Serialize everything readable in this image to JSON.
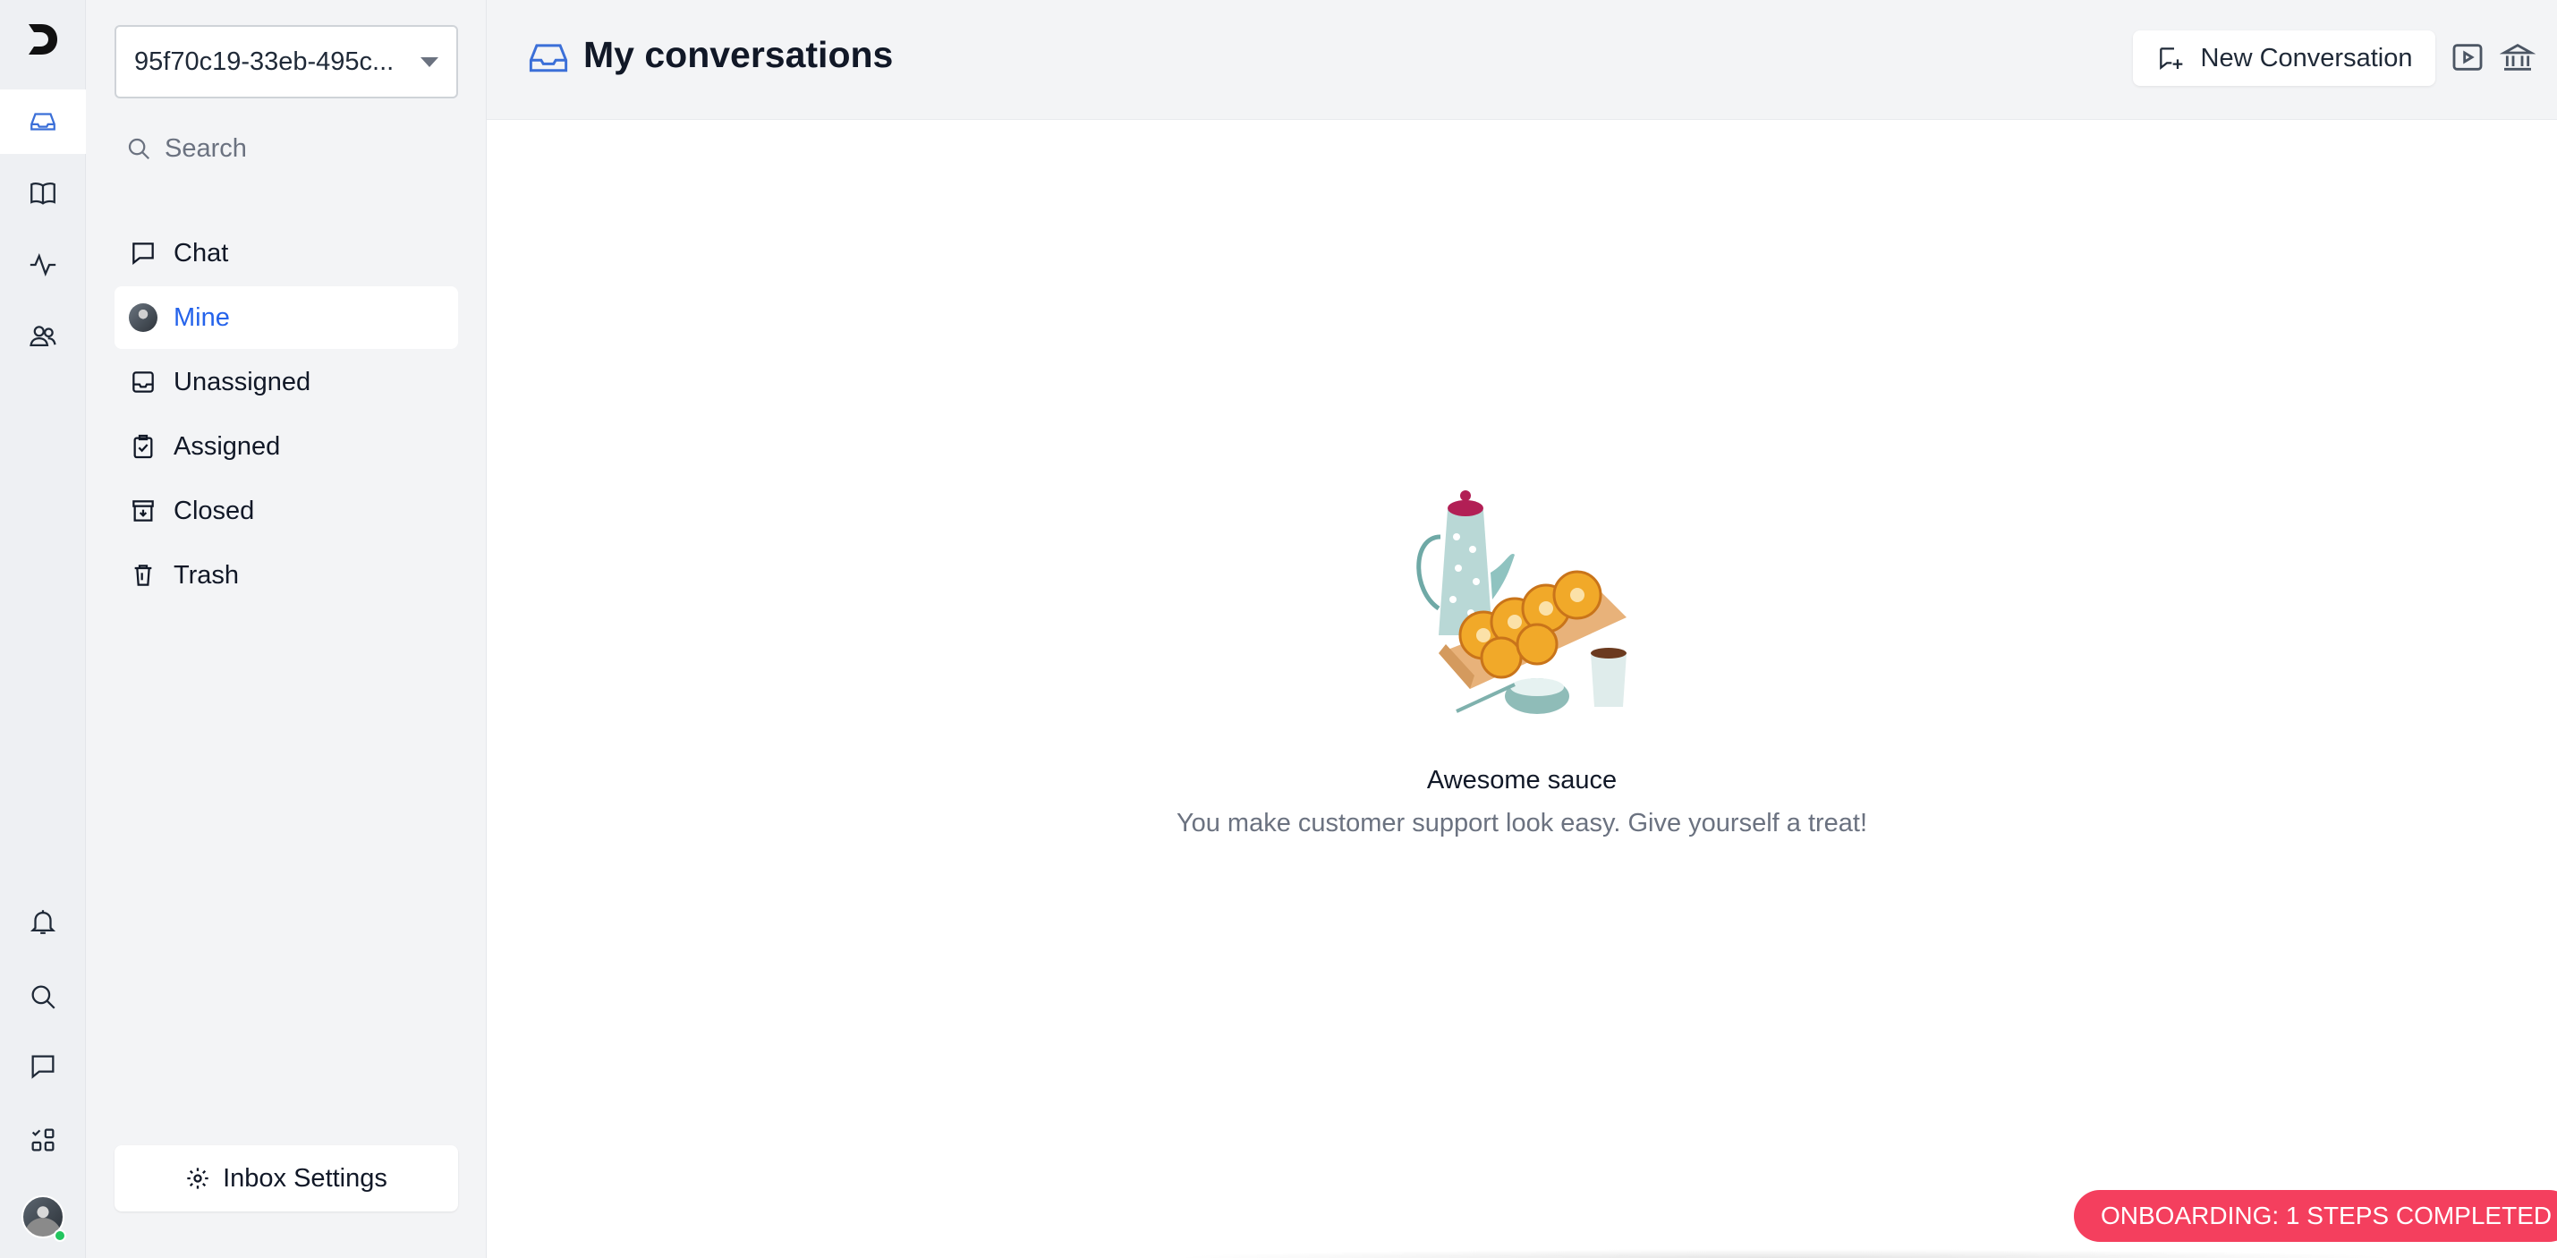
{
  "rail": {
    "logo": "D-logo-icon",
    "top_icons": [
      "inbox-icon",
      "book-icon",
      "activity-icon",
      "users-icon"
    ],
    "bottom_icons": [
      "bell-icon",
      "search-icon",
      "chat-icon",
      "apps-icon"
    ]
  },
  "sidebar": {
    "account_value": "95f70c19-33eb-495c...",
    "search_label": "Search",
    "nav": [
      {
        "label": "Chat",
        "icon": "chat-bubble-icon"
      },
      {
        "label": "Mine",
        "icon": "avatar"
      },
      {
        "label": "Unassigned",
        "icon": "inbox-tray-icon"
      },
      {
        "label": "Assigned",
        "icon": "clipboard-check-icon"
      },
      {
        "label": "Closed",
        "icon": "archive-icon"
      },
      {
        "label": "Trash",
        "icon": "trash-icon"
      }
    ],
    "inbox_settings_label": "Inbox Settings"
  },
  "main": {
    "title": "My conversations",
    "new_conversation_label": "New Conversation",
    "empty_title": "Awesome sauce",
    "empty_subtitle": "You make customer support look easy. Give yourself a treat!"
  },
  "onboarding": {
    "label": "ONBOARDING: 1 STEPS COMPLETED",
    "color": "#f43f5e"
  },
  "colors": {
    "accent": "#2563eb",
    "rail_bg": "#eef0f3",
    "sidebar_bg": "#f3f4f6"
  }
}
